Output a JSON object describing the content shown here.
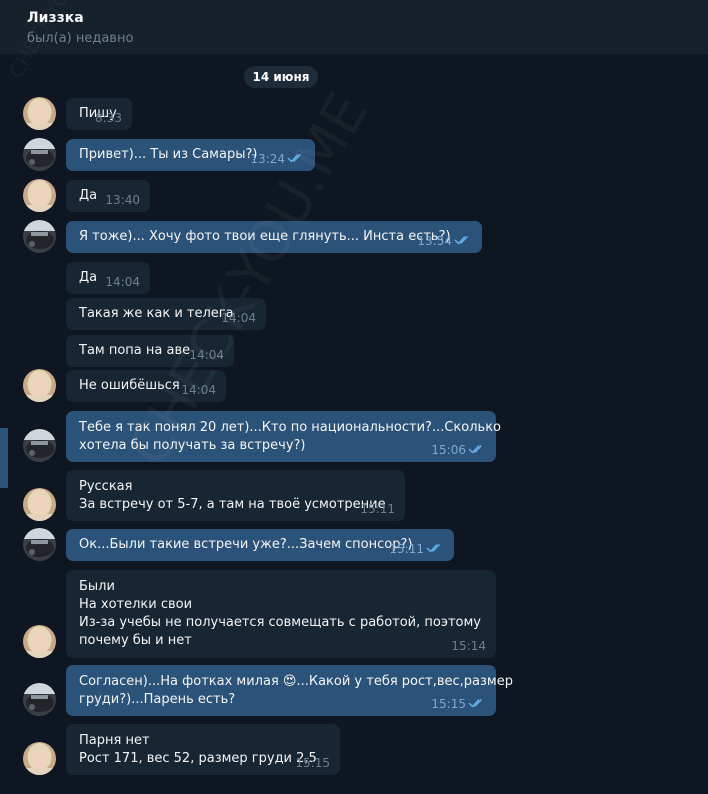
{
  "header": {
    "name": "Лиззка",
    "status": "был(а) недавно"
  },
  "date_label": "14 июня",
  "watermark": "CHECK-YOU.ME",
  "colors": {
    "bg": "#0e1621",
    "incoming": "#182533",
    "outgoing": "#2b5278",
    "ticks": "#64b5ef"
  },
  "messages": [
    {
      "dir": "in",
      "text": "Пишу",
      "time": "8:33"
    },
    {
      "dir": "out",
      "text": "Привет)... Ты из Самары?)",
      "time": "13:24",
      "read": true
    },
    {
      "dir": "in",
      "text": "Да",
      "time": "13:40"
    },
    {
      "dir": "out",
      "text": "Я тоже)... Хочу фото твои еще глянуть... Инста есть?)",
      "time": "13:54",
      "read": true
    },
    {
      "dir": "in",
      "text": "Да",
      "time": "14:04"
    },
    {
      "dir": "in",
      "text": "Такая же как и телега",
      "time": "14:04"
    },
    {
      "dir": "in",
      "text": "Там попа на аве",
      "time": "14:04"
    },
    {
      "dir": "in",
      "text": "Не ошибёшься",
      "time": "14:04"
    },
    {
      "dir": "out",
      "text": "Тебе я так понял 20 лет)...Кто по национальности?...Сколько\nхотела бы получать за встречу?)",
      "time": "15:06",
      "read": true
    },
    {
      "dir": "in",
      "text": "Русская\nЗа встречу от 5-7, а там на твоё усмотрение",
      "time": "15:11"
    },
    {
      "dir": "out",
      "text": "Ок...Были такие встречи уже?...Зачем спонсор?)",
      "time": "15:11",
      "read": true
    },
    {
      "dir": "in",
      "text": "Были\nНа хотелки свои\nИз-за учебы не получается совмещать с работой, поэтому\nпочему бы и нет",
      "time": "15:14"
    },
    {
      "dir": "out",
      "text": "Согласен)...На фотках милая 😍...Какой у тебя рост,вес,размер\nгруди?)...Парень есть?",
      "time": "15:15",
      "read": true
    },
    {
      "dir": "in",
      "text": "Парня нет\nРост 171, вес 52, размер груди 2,5",
      "time": "15:15"
    }
  ]
}
